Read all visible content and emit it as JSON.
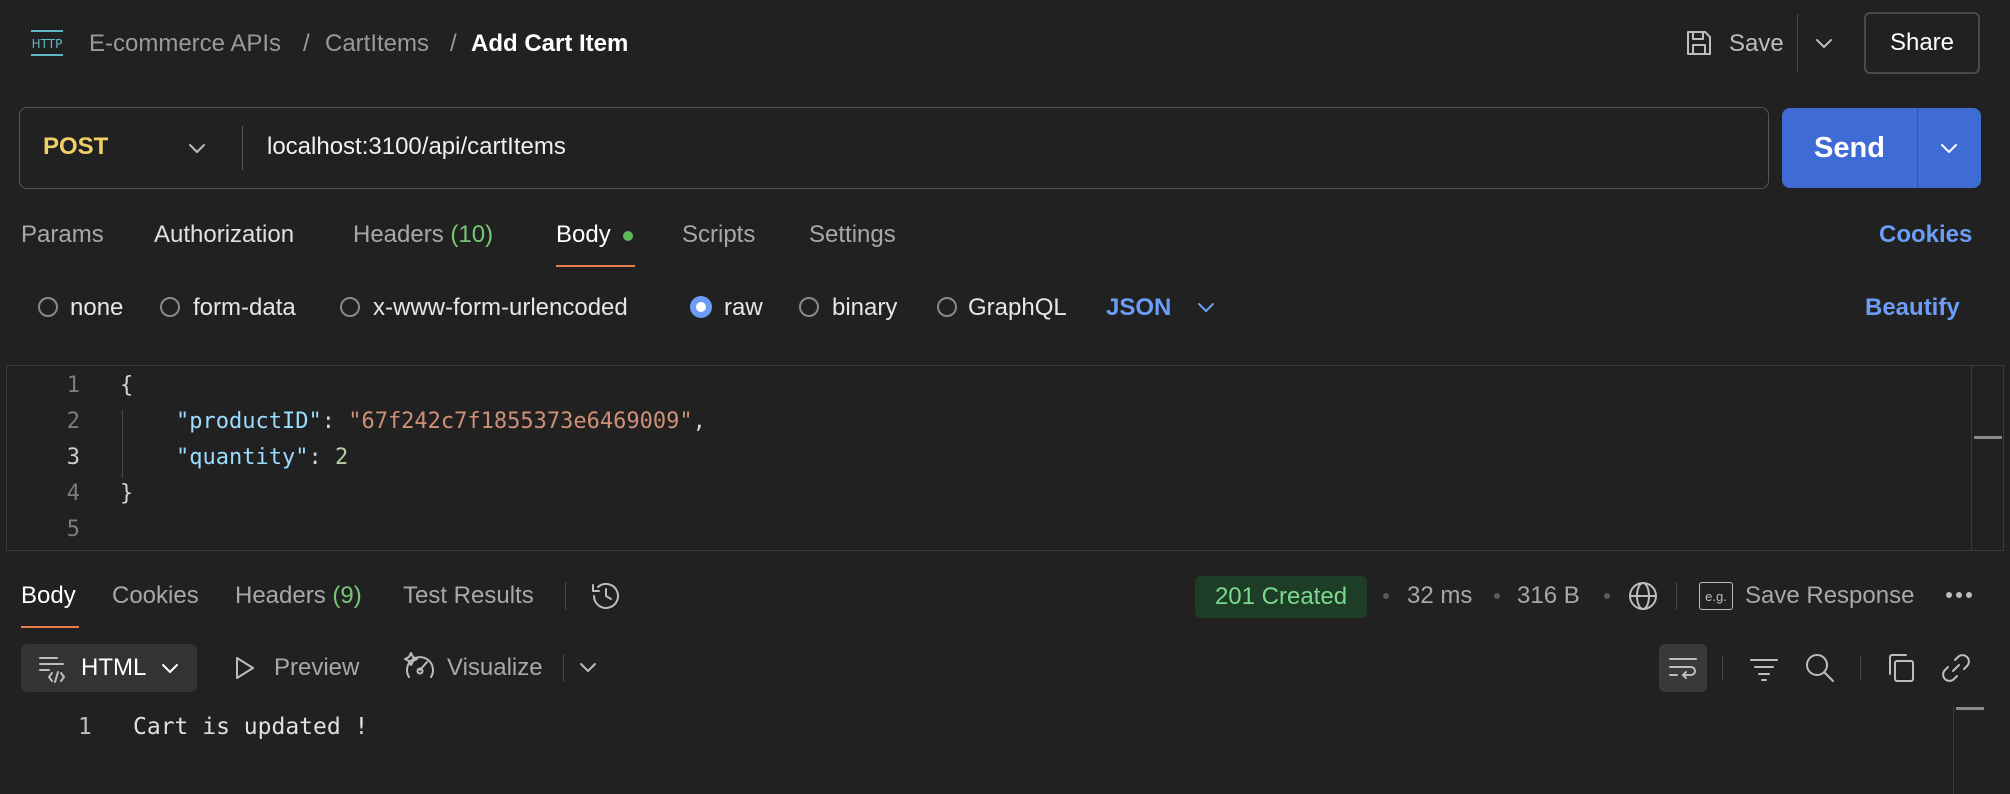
{
  "header": {
    "icon_text": "HTTP",
    "breadcrumb": [
      "E-commerce APIs",
      "CartItems"
    ],
    "title": "Add Cart Item",
    "save_label": "Save",
    "share_label": "Share"
  },
  "request": {
    "method": "POST",
    "url": "localhost:3100/api/cartItems",
    "send_label": "Send"
  },
  "request_tabs": {
    "params": "Params",
    "authorization": "Authorization",
    "headers": "Headers",
    "headers_count": "(10)",
    "body": "Body",
    "scripts": "Scripts",
    "settings": "Settings",
    "cookies": "Cookies"
  },
  "body_types": {
    "none": "none",
    "form_data": "form-data",
    "urlencoded": "x-www-form-urlencoded",
    "raw": "raw",
    "binary": "binary",
    "graphql": "GraphQL",
    "format": "JSON",
    "beautify": "Beautify",
    "selected": "raw"
  },
  "editor": {
    "line_numbers": [
      "1",
      "2",
      "3",
      "4",
      "5"
    ],
    "open_brace": "{",
    "close_brace": "}",
    "key1": "\"productID\"",
    "val1": "\"67f242c7f1855373e6469009\"",
    "key2": "\"quantity\"",
    "val2": "2",
    "colon": ": ",
    "comma": ","
  },
  "response_tabs": {
    "body": "Body",
    "cookies": "Cookies",
    "headers": "Headers",
    "headers_count": "(9)",
    "test_results": "Test Results"
  },
  "response_meta": {
    "status": "201 Created",
    "time": "32 ms",
    "size": "316 B",
    "save_response": "Save Response",
    "eg_badge": "e.g."
  },
  "response_toolbar": {
    "format": "HTML",
    "preview": "Preview",
    "visualize": "Visualize"
  },
  "response_body": {
    "line_number": "1",
    "text": "Cart is updated !"
  },
  "colors": {
    "background": "#212121",
    "method": "#f0cf65",
    "send": "#3f6cd4",
    "accent_link": "#6b9cf6",
    "status_bg": "#1e3d26",
    "status_text": "#7bd88f",
    "active_tab_underline": "#e97c50"
  }
}
